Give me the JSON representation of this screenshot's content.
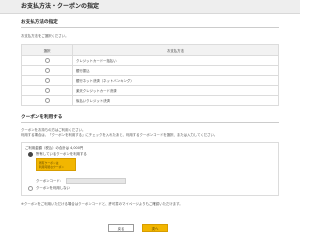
{
  "header": {
    "title": "お支払方法・クーポンの指定"
  },
  "payment": {
    "section_title": "お支払方法の指定",
    "instruction": "お支払方法をご選択ください。",
    "table_headers": [
      "選択",
      "お支払方法"
    ],
    "options": [
      {
        "label": "クレジットカード一括払い",
        "selected": false
      },
      {
        "label": "銀行振込",
        "selected": false
      },
      {
        "label": "銀行ネット決済（ネットバンキング）",
        "selected": false
      },
      {
        "label": "楽天クレジットカード決済",
        "selected": false
      },
      {
        "label": "後払いクレジット決済",
        "selected": false
      }
    ]
  },
  "coupon": {
    "section_title": "クーポンを利用する",
    "desc_line1": "クーポンをお持ちの方はご利用ください。",
    "desc_line2": "利用する場合は、「クーポンを利用する」にチェックを入れたあと、利用するクーポンコードを選択、または入力してください。",
    "box_header": "ご利用金額（税込）の合計は 4,000円",
    "option_use_label": "所有しているクーポンを利用する",
    "yellow_line1": "所有クーポンは",
    "yellow_line2": "利用可能なクーポン",
    "code_label": "クーポンコード：",
    "option_none_label": "クーポンを利用しない",
    "note": "※クーポンをご利用いただける場合はクーポンコードと、許可書のマイページよりもご確認いただけます。"
  },
  "buttons": {
    "back": "戻る",
    "next": "次へ"
  },
  "colors": {
    "accent": "#f2b600",
    "header_bg": "#eeeeee"
  }
}
